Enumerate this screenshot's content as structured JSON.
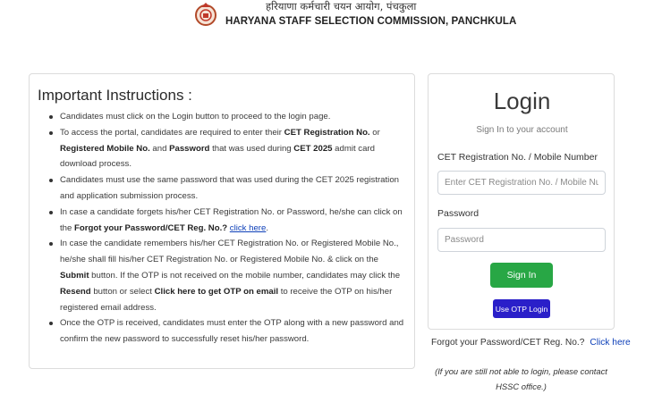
{
  "header": {
    "hindi_title": "हरियाणा कर्मचारी चयन आयोग, पंचकुला",
    "english_title": "HARYANA STAFF SELECTION COMMISSION, PANCHKULA",
    "logo_icon": "emblem-icon"
  },
  "instructions": {
    "title": "Important Instructions :",
    "item1": "Candidates must click on the Login button to proceed to the login page.",
    "item2": {
      "t1": "To access the portal, candidates are required to enter their ",
      "b1": "CET Registration No.",
      "t2": " or ",
      "b2": "Registered Mobile No.",
      "t3": " and ",
      "b3": "Password",
      "t4": " that was used during ",
      "b4": "CET 2025",
      "t5": " admit card download process."
    },
    "item3": "Candidates must use the same password that was used during the CET 2025 registration and application submission process.",
    "item4": {
      "t1": "In case a candidate forgets his/her CET Registration No. or Password, he/she can click on the ",
      "b1": "Forgot your Password/CET Reg. No.?",
      "link": "click here",
      "t2": "."
    },
    "item5": {
      "t1": "In case the candidate remembers his/her CET Registration No. or Registered Mobile No., he/she shall fill his/her CET Registration No. or Registered Mobile No. & click on the ",
      "b1": "Submit",
      "t2": " button. If the OTP is not received on the mobile number, candidates may click the ",
      "b2": "Resend",
      "t3": " button or select ",
      "b3": "Click here to get OTP on email",
      "t4": " to receive the OTP on his/her registered email address."
    },
    "item6": "Once the OTP is received, candidates must enter the OTP along with a new password and confirm the new password to successfully reset his/her password."
  },
  "login": {
    "title": "Login",
    "subtitle": "Sign In to your account",
    "username_label": "CET Registration No. / Mobile Number",
    "username_placeholder": "Enter CET Registration No. / Mobile Number",
    "username_value": "",
    "password_label": "Password",
    "password_placeholder": "Password",
    "password_value": "",
    "signin_label": "Sign In",
    "otp_label": "Use OTP Login"
  },
  "forgot": {
    "text": "Forgot your Password/CET Reg. No.?",
    "link": "Click here"
  },
  "note": "(If you are still not able to login, please contact HSSC office.)",
  "colors": {
    "signin": "#28a745",
    "otp": "#2a1fc9",
    "link": "#0d3fb8"
  }
}
